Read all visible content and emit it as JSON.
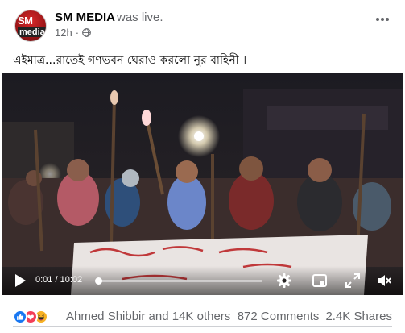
{
  "post": {
    "page_name": "SM MEDIA",
    "status": "was live.",
    "time": "12h",
    "dot": "·",
    "avatar_logo_top": "SM",
    "avatar_logo_bottom": "media",
    "caption": "এইমাত্র...রাতেই গণভবন ঘেরাও করলো নুর বাহিনী ।",
    "more_icon": "ellipsis-icon",
    "privacy_icon": "globe-icon"
  },
  "video": {
    "current_time": "0:01",
    "separator": "/",
    "duration": "10:02",
    "progress": 0.0017,
    "controls": [
      "play-icon",
      "settings-icon",
      "picture-in-picture-icon",
      "fullscreen-icon",
      "mute-icon"
    ]
  },
  "engagement": {
    "reaction_icons": [
      "like-icon",
      "love-icon",
      "haha-icon"
    ],
    "reactors": "Ahmed Shibbir and 14K others",
    "comments": "872 Comments",
    "shares": "2.4K Shares",
    "colors": {
      "like": "#1877f2",
      "love": "#f33e58",
      "haha": "#f7b125"
    }
  }
}
